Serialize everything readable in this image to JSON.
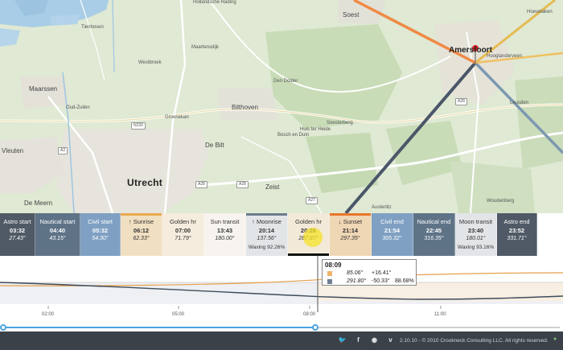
{
  "map": {
    "places": [
      {
        "name": "Hollandsche Rading",
        "cls": "place"
      },
      {
        "name": "Tienhoven",
        "cls": "place"
      },
      {
        "name": "Maartensdijk",
        "cls": "place"
      },
      {
        "name": "Westbroek",
        "cls": "place"
      },
      {
        "name": "Maarssen",
        "cls": "place town"
      },
      {
        "name": "Oud-Zuilen",
        "cls": "place"
      },
      {
        "name": "Groenekan",
        "cls": "place"
      },
      {
        "name": "Bilthoven",
        "cls": "place town"
      },
      {
        "name": "Den Dolder",
        "cls": "place"
      },
      {
        "name": "Soest",
        "cls": "place town"
      },
      {
        "name": "Soesterberg",
        "cls": "place"
      },
      {
        "name": "Huis ter Heide",
        "cls": "place"
      },
      {
        "name": "Bosch en Duin",
        "cls": "place"
      },
      {
        "name": "De Bilt",
        "cls": "place town"
      },
      {
        "name": "Utrecht",
        "cls": "place city"
      },
      {
        "name": "Vleuten",
        "cls": "place town"
      },
      {
        "name": "De Meern",
        "cls": "place town"
      },
      {
        "name": "Zeist",
        "cls": "place town"
      },
      {
        "name": "Amersfoort",
        "cls": "place city2"
      },
      {
        "name": "Leusden",
        "cls": "place"
      },
      {
        "name": "Hoevelaken",
        "cls": "place"
      },
      {
        "name": "Woudenberg",
        "cls": "place"
      },
      {
        "name": "Austerlitz",
        "cls": "place"
      },
      {
        "name": "Hooglanderveen",
        "cls": "place"
      }
    ],
    "shields": [
      "N230",
      "A2",
      "A28",
      "A28",
      "A27",
      "A28"
    ]
  },
  "strip": [
    {
      "label": "Astro start",
      "time": "03:32",
      "az": "27.43°",
      "extra": "",
      "bg": "#4f5a66",
      "theme": "dark",
      "top": "",
      "bottom": "",
      "icon": ""
    },
    {
      "label": "Nautical start",
      "time": "04:40",
      "az": "43.15°",
      "extra": "",
      "bg": "#5f7387",
      "theme": "dark",
      "top": "",
      "bottom": "",
      "icon": ""
    },
    {
      "label": "Civil start",
      "time": "05:32",
      "az": "54.30°",
      "extra": "",
      "bg": "#7fa0c2",
      "theme": "dark",
      "top": "",
      "bottom": "",
      "icon": ""
    },
    {
      "label": "Sunrise",
      "time": "06:12",
      "az": "62.33°",
      "extra": "",
      "bg": "#f1dfc2",
      "theme": "light",
      "top": "#e9a94f",
      "bottom": "",
      "icon": "↑"
    },
    {
      "label": "Golden hr",
      "time": "07:00",
      "az": "71.79°",
      "extra": "",
      "bg": "#f6ecdd",
      "theme": "light",
      "top": "",
      "bottom": "",
      "icon": ""
    },
    {
      "label": "Sun transit",
      "time": "13:43",
      "az": "180.00°",
      "extra": "",
      "bg": "#f7f3ee",
      "theme": "light",
      "top": "",
      "bottom": "",
      "icon": ""
    },
    {
      "label": "Moonrise",
      "time": "20:14",
      "az": "137.56°",
      "extra": "Waxing 92.26%",
      "bg": "#e2e5e8",
      "theme": "light",
      "top": "#6c7c8c",
      "bottom": "",
      "icon": "↑"
    },
    {
      "label": "Golden hr",
      "time": "20:26",
      "az": "287.87°",
      "extra": "",
      "bg": "#f3e9d8",
      "theme": "light",
      "top": "",
      "bottom": "#111111",
      "icon": ""
    },
    {
      "label": "Sunset",
      "time": "21:14",
      "az": "297.35°",
      "extra": "",
      "bg": "#efd6b4",
      "theme": "light",
      "top": "#e9772b",
      "bottom": "",
      "icon": "↓"
    },
    {
      "label": "Civil end",
      "time": "21:54",
      "az": "305.32°",
      "extra": "",
      "bg": "#7fa0c2",
      "theme": "dark",
      "top": "",
      "bottom": "",
      "icon": ""
    },
    {
      "label": "Nautical end",
      "time": "22:45",
      "az": "316.35°",
      "extra": "",
      "bg": "#5f7387",
      "theme": "dark",
      "top": "",
      "bottom": "",
      "icon": ""
    },
    {
      "label": "Moon transit",
      "time": "23:40",
      "az": "180.01°",
      "extra": "Waxing 93.16%",
      "bg": "#e2e5e8",
      "theme": "light",
      "top": "",
      "bottom": "",
      "icon": ""
    },
    {
      "label": "Astro end",
      "time": "23:52",
      "az": "331.71°",
      "extra": "",
      "bg": "#4f5a66",
      "theme": "dark",
      "top": "",
      "bottom": "",
      "icon": ""
    }
  ],
  "graph": {
    "ticks": [
      "02:00",
      "05:00",
      "08:00",
      "11:00"
    ]
  },
  "tooltip": {
    "time": "08:09",
    "rows": [
      {
        "color": "#f0b46a",
        "az": "85.06°",
        "alt": "+16.41°",
        "pct": ""
      },
      {
        "color": "#6e7f92",
        "az": "291.80°",
        "alt": "-50.33°",
        "pct": "88.68%"
      }
    ]
  },
  "scrubber": {
    "progress_percent": 56
  },
  "footer": {
    "icons": [
      "twitter-icon",
      "facebook-icon",
      "instagram-icon",
      "vimeo-icon"
    ],
    "version": "2.10.10 - © 2010 Crookneck Consulting LLC. All rights reserved."
  }
}
